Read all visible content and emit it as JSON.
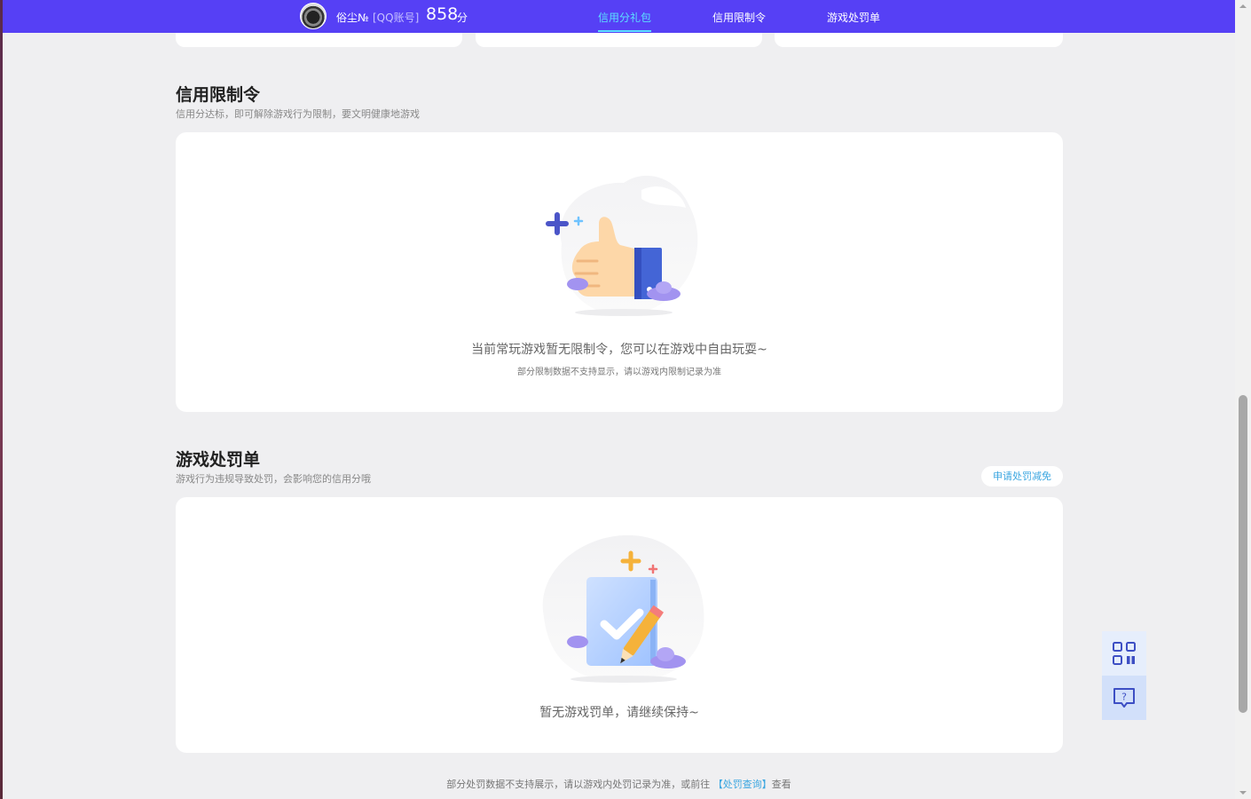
{
  "header": {
    "user_name": "俗尘№",
    "account_label": "[QQ账号]",
    "score": "858",
    "score_unit": "分",
    "tabs": [
      {
        "label": "信用分礼包",
        "active": true
      },
      {
        "label": "信用限制令",
        "active": false
      },
      {
        "label": "游戏处罚单",
        "active": false
      }
    ]
  },
  "restriction": {
    "title": "信用限制令",
    "subtitle": "信用分达标，即可解除游戏行为限制，要文明健康地游戏",
    "empty_message": "当前常玩游戏暂无限制令，您可以在游戏中自由玩耍~",
    "empty_note": "部分限制数据不支持显示，请以游戏内限制记录为准"
  },
  "penalty": {
    "title": "游戏处罚单",
    "subtitle": "游戏行为违规导致处罚，会影响您的信用分哦",
    "appeal_button": "申请处罚减免",
    "empty_message": "暂无游戏罚单，请继续保持~"
  },
  "footer": {
    "note_prefix": "部分处罚数据不支持展示，请以游戏内处罚记录为准，或前往",
    "link": "【处罚查询】",
    "note_suffix": "查看"
  },
  "side_buttons": [
    {
      "icon": "qr-code-icon"
    },
    {
      "icon": "feedback-question-icon"
    }
  ],
  "colors": {
    "header_bg": "#5640f5",
    "accent": "#5ce0ff",
    "link": "#3aa6e0",
    "page_bg": "#efeff1"
  }
}
